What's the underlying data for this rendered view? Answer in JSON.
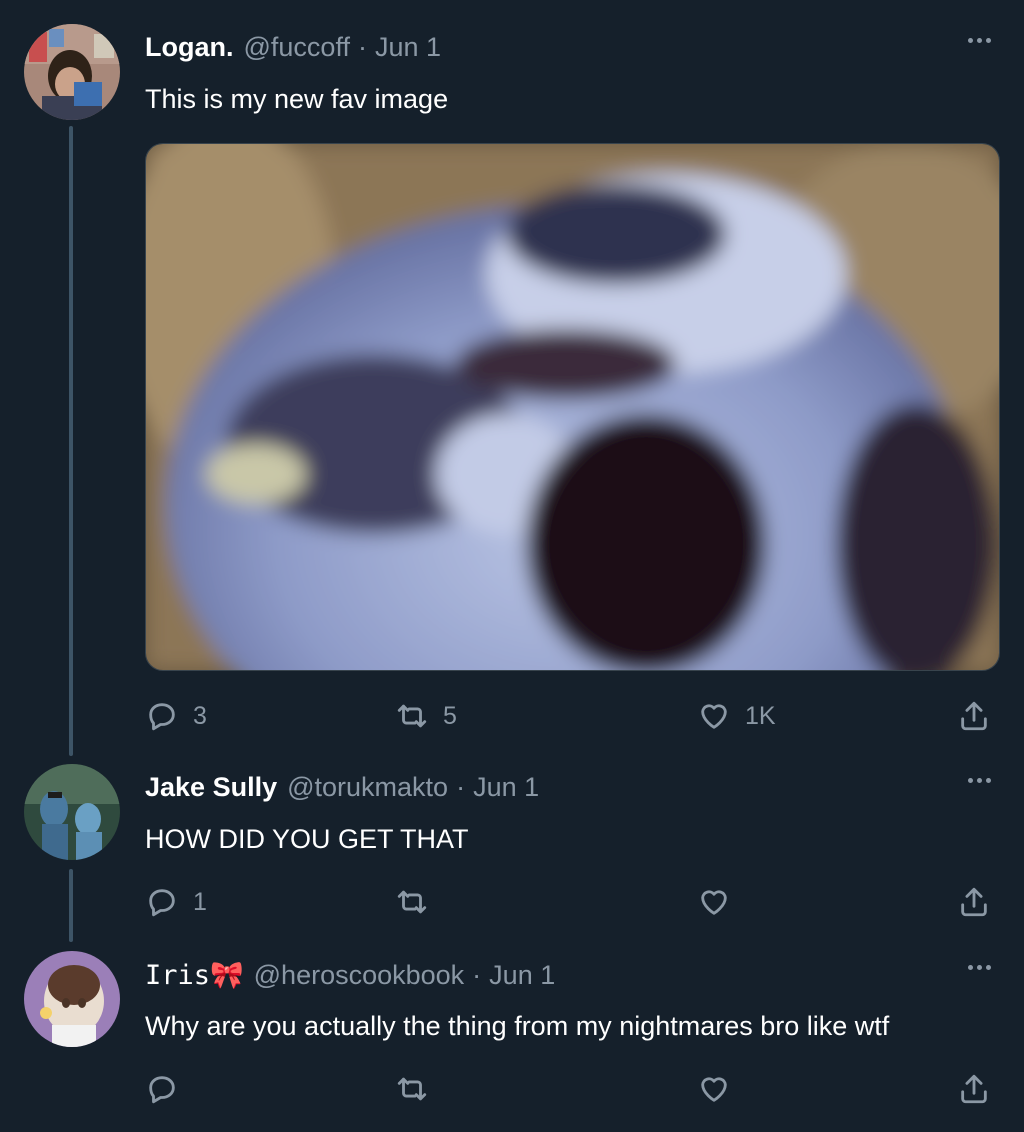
{
  "tweets": [
    {
      "name": "Logan.",
      "handle": "@fuccoff",
      "separator": "·",
      "date": "Jun 1",
      "text": "This is my new fav image",
      "reply_count": "3",
      "retweet_count": "5",
      "like_count": "1K",
      "has_media": true
    },
    {
      "name": "Jake Sully",
      "handle": "@torukmakto",
      "separator": "·",
      "date": "Jun 1",
      "text": "HOW DID YOU GET THAT",
      "reply_count": "1",
      "retweet_count": "",
      "like_count": ""
    },
    {
      "name": "Iris🎀",
      "handle": "@heroscookbook",
      "separator": "·",
      "date": "Jun 1",
      "text": "Why are you actually the thing from my nightmares bro like wtf",
      "reply_count": "",
      "retweet_count": "",
      "like_count": ""
    }
  ],
  "icons": {
    "reply": "reply-icon",
    "retweet": "retweet-icon",
    "like": "heart-icon",
    "share": "share-icon",
    "more": "more-icon"
  },
  "colors": {
    "background": "#15202b",
    "secondary_text": "#8b98a5",
    "thread_line": "#3d5466"
  }
}
